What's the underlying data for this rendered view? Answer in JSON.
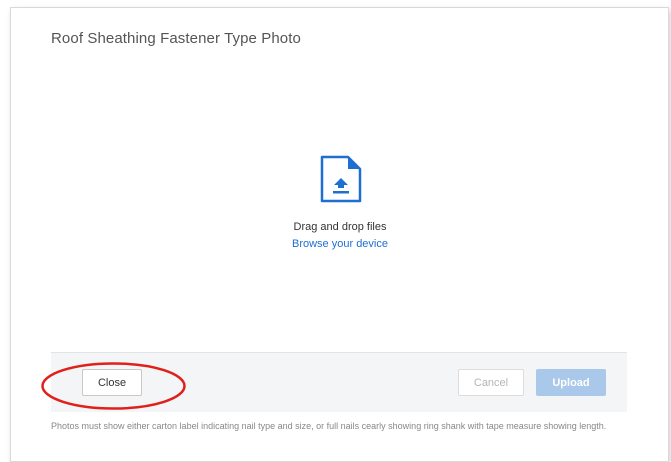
{
  "dialog": {
    "title": "Roof Sheathing Fastener Type Photo"
  },
  "drop_zone": {
    "icon": "file-upload-icon",
    "prompt": "Drag and drop files",
    "browse_label": "Browse your device"
  },
  "footer": {
    "close_label": "Close",
    "cancel_label": "Cancel",
    "upload_label": "Upload"
  },
  "note": "Photos must show either carton label indicating nail type and size, or full nails cearly showing ring shank with tape measure showing length.",
  "colors": {
    "accent": "#1f6fd1",
    "upload_disabled": "#a9c8ea",
    "annotation_ring": "#e0201b"
  }
}
